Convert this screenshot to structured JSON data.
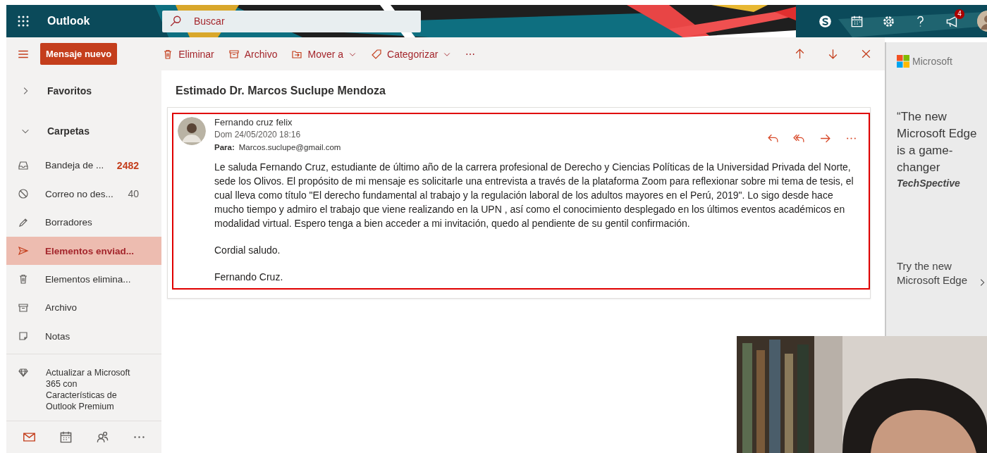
{
  "header": {
    "app_name": "Outlook",
    "search": {
      "placeholder": "Buscar"
    },
    "icons": [
      {
        "kind": "skype"
      },
      {
        "kind": "calendar"
      },
      {
        "kind": "settings"
      },
      {
        "kind": "help"
      },
      {
        "kind": "megaphone",
        "badge": "4"
      },
      {
        "kind": "avatar"
      }
    ]
  },
  "command_bar": {
    "new_button": "Mensaje nuevo",
    "actions": [
      {
        "kind": "delete",
        "label": "Eliminar",
        "dropdown": false
      },
      {
        "kind": "archive",
        "label": "Archivo",
        "dropdown": false
      },
      {
        "kind": "move",
        "label": "Mover a",
        "dropdown": true
      },
      {
        "kind": "tag",
        "label": "Categorizar",
        "dropdown": true
      },
      {
        "kind": "more",
        "label": "⋯"
      }
    ],
    "nav": [
      {
        "kind": "up"
      },
      {
        "kind": "down"
      },
      {
        "kind": "close"
      }
    ]
  },
  "sidebar": {
    "sections": [
      {
        "label": "Favoritos",
        "expanded": false
      },
      {
        "label": "Carpetas",
        "expanded": true
      }
    ],
    "folders": [
      {
        "kind": "inbox",
        "name": "Bandeja de ...",
        "count": "2482",
        "unread": true,
        "selected": false
      },
      {
        "kind": "junk",
        "name": "Correo no des...",
        "count": "40",
        "unread": false,
        "selected": false
      },
      {
        "kind": "drafts",
        "name": "Borradores",
        "selected": false
      },
      {
        "kind": "sent",
        "name": "Elementos enviad...",
        "selected": true
      },
      {
        "kind": "deleted",
        "name": "Elementos elimina...",
        "selected": false
      },
      {
        "kind": "archive",
        "name": "Archivo",
        "selected": false
      },
      {
        "kind": "notes",
        "name": "Notas",
        "selected": false
      }
    ],
    "upgrade": "Actualizar a Microsoft 365 con Características de Outlook Premium",
    "bottom_nav": [
      {
        "kind": "mail",
        "selected": true
      },
      {
        "kind": "calendar",
        "selected": false
      },
      {
        "kind": "people",
        "selected": false
      },
      {
        "kind": "more",
        "selected": false
      }
    ]
  },
  "message": {
    "subject": "Estimado Dr. Marcos Suclupe Mendoza",
    "sender": "Fernando cruz felix",
    "date": "Dom 24/05/2020 18:16",
    "to_label": "Para:",
    "to": "Marcos.suclupe@gmail.com",
    "actions": [
      {
        "kind": "reply"
      },
      {
        "kind": "reply-all"
      },
      {
        "kind": "forward"
      },
      {
        "kind": "more"
      }
    ],
    "body": [
      "Le saluda Fernando Cruz, estudiante de último año de la carrera profesional de Derecho y Ciencias Políticas de la Universidad Privada del Norte, sede los Olivos. El propósito de mi mensaje es solicitarle una entrevista a través de la plataforma Zoom para reflexionar sobre mi tema de tesis, el cual lleva como título \"El derecho fundamental al trabajo y la regulación laboral de los adultos mayores en el Perú, 2019\". Lo sigo desde hace mucho tiempo y admiro el trabajo que viene realizando en la UPN , así como el conocimiento desplegado en los últimos eventos académicos en modalidad virtual. Espero tenga a bien acceder a mi invitación, quedo al pendiente de su gentil confirmación.",
      "Cordial saludo.",
      "Fernando Cruz."
    ]
  },
  "ad": {
    "brand": "Microsoft",
    "quote": "“The new Microsoft Edge is a game-changer",
    "source": "TechSpective",
    "cta": "Try the new Microsoft Edge"
  }
}
